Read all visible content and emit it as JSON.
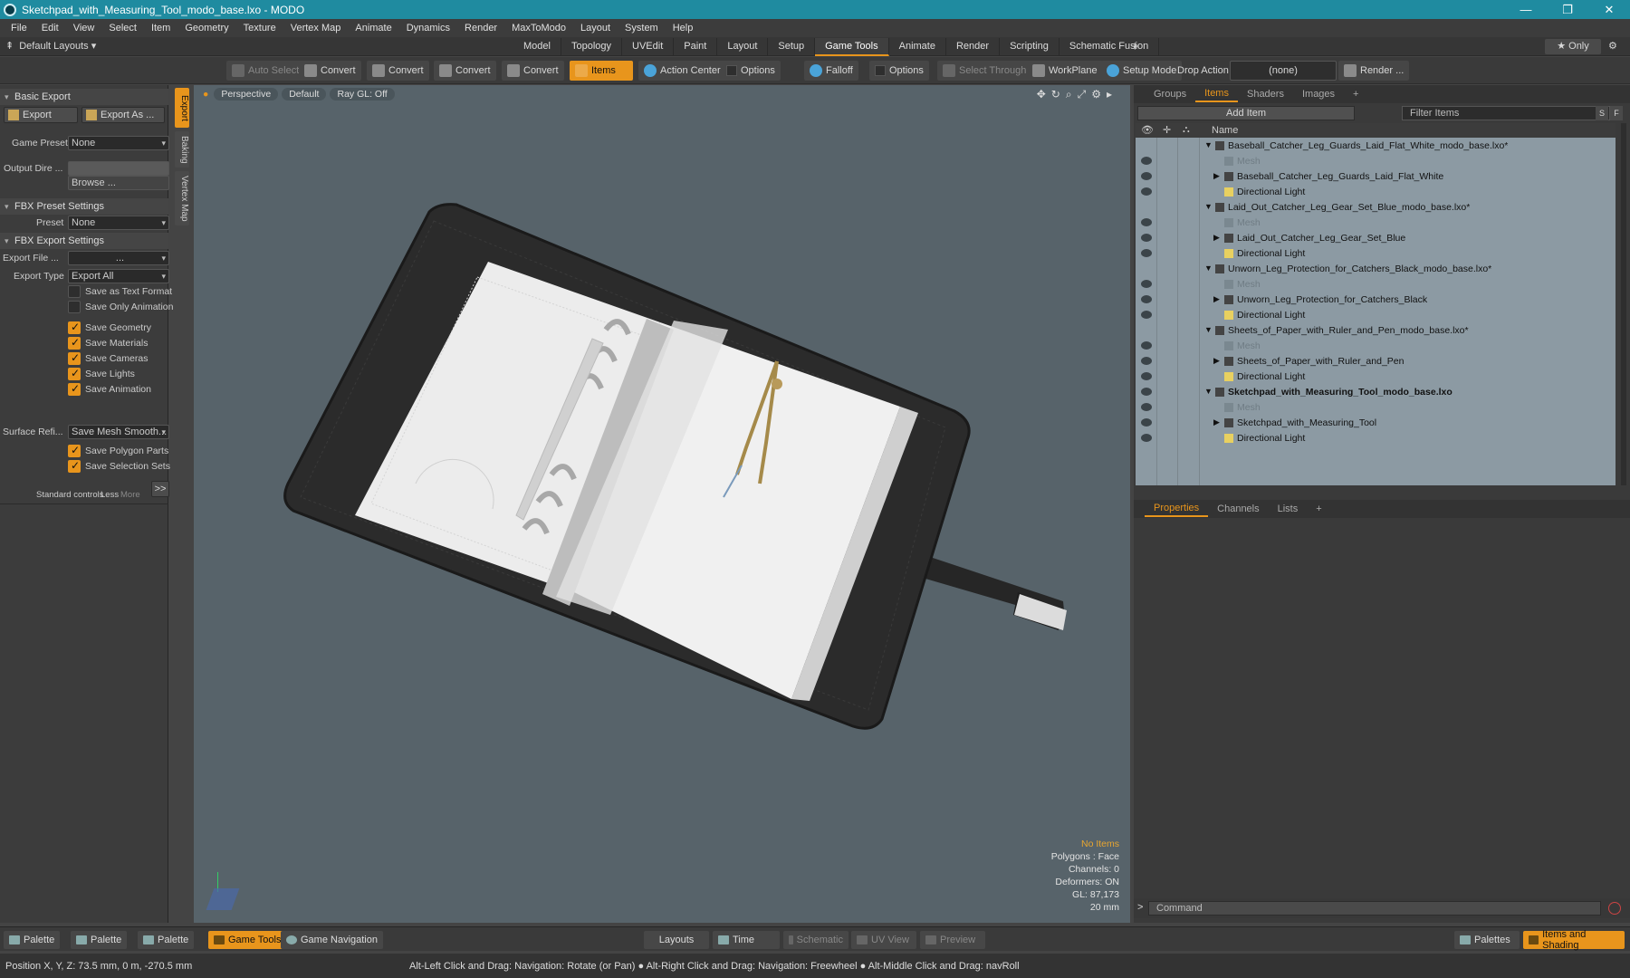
{
  "window": {
    "title": "Sketchpad_with_Measuring_Tool_modo_base.lxo - MODO",
    "min": "—",
    "max": "❐",
    "close": "✕"
  },
  "menu": [
    "File",
    "Edit",
    "View",
    "Select",
    "Item",
    "Geometry",
    "Texture",
    "Vertex Map",
    "Animate",
    "Dynamics",
    "Render",
    "MaxToModo",
    "Layout",
    "System",
    "Help"
  ],
  "layoutbar": {
    "default_layouts": "Default Layouts ▾",
    "tabs": [
      "Model",
      "Topology",
      "UVEdit",
      "Paint",
      "Layout",
      "Setup",
      "Game Tools",
      "Animate",
      "Render",
      "Scripting",
      "Schematic Fusion"
    ],
    "active_tab": "Game Tools",
    "plus": "+",
    "only": "★ Only"
  },
  "toolbar": {
    "auto_select": "Auto Select",
    "convert1": "Convert",
    "convert2": "Convert",
    "convert3": "Convert",
    "convert4": "Convert",
    "items": "Items",
    "action_center": "Action Center",
    "options1": "Options",
    "falloff": "Falloff",
    "options2": "Options",
    "select_through": "Select Through",
    "workplane": "WorkPlane",
    "setup_mode": "Setup Mode",
    "drop_action": "Drop Action",
    "drop_value": "(none)",
    "render": "Render ..."
  },
  "left": {
    "basic_export": "Basic Export",
    "export": "Export",
    "export_as": "Export As ...",
    "game_preset_label": "Game Preset",
    "game_preset": "None",
    "output_dir_label": "Output Dire ...",
    "browse": "Browse ...",
    "fbx_preset_settings": "FBX Preset Settings",
    "preset_label": "Preset",
    "preset": "None",
    "fbx_export_settings": "FBX Export Settings",
    "export_file_label": "Export File ...",
    "export_file": "...",
    "export_type_label": "Export Type",
    "export_type": "Export All",
    "checks": [
      {
        "label": "Save as Text Format",
        "on": false
      },
      {
        "label": "Save Only Animation",
        "on": false
      },
      {
        "label": "Save Geometry",
        "on": true
      },
      {
        "label": "Save Materials",
        "on": true
      },
      {
        "label": "Save Cameras",
        "on": true
      },
      {
        "label": "Save Lights",
        "on": true
      },
      {
        "label": "Save Animation",
        "on": true
      }
    ],
    "surface_label": "Surface Refi...",
    "surface_value": "Save Mesh Smooth...",
    "checks2": [
      {
        "label": "Save Polygon Parts",
        "on": true
      },
      {
        "label": "Save Selection Sets",
        "on": true
      }
    ],
    "standard_controls": "Standard controls",
    "less": "Less",
    "more": "More",
    "expand": ">>",
    "vtabs": [
      "Export",
      "Baking",
      "Vertex Map"
    ]
  },
  "viewport": {
    "perspective": "Perspective",
    "default": "Default",
    "raygl": "Ray GL: Off",
    "info": {
      "no_items": "No Items",
      "polygons": "Polygons : Face",
      "channels": "Channels: 0",
      "deformers": "Deformers: ON",
      "gl": "GL: 87,173",
      "scale": "20 mm"
    }
  },
  "right": {
    "tabs": [
      "Groups",
      "Items",
      "Shaders",
      "Images"
    ],
    "active": "Items",
    "plus": "+",
    "add_item": "Add Item",
    "filter": "Filter Items",
    "s": "S",
    "f": "F",
    "col_name": "Name",
    "rows": [
      {
        "name": "Baseball_Catcher_Leg_Guards_Laid_Flat_White_modo_base.lxo*",
        "lvl": 0,
        "eye": false,
        "bold": false,
        "dim": false
      },
      {
        "name": "Mesh",
        "lvl": 1,
        "eye": true,
        "bold": false,
        "dim": true
      },
      {
        "name": "Baseball_Catcher_Leg_Guards_Laid_Flat_White",
        "lvl": 1,
        "eye": true,
        "bold": false,
        "dim": false
      },
      {
        "name": "Directional Light",
        "lvl": 1,
        "eye": true,
        "bold": false,
        "dim": false
      },
      {
        "name": "Laid_Out_Catcher_Leg_Gear_Set_Blue_modo_base.lxo*",
        "lvl": 0,
        "eye": false,
        "bold": false,
        "dim": false
      },
      {
        "name": "Mesh",
        "lvl": 1,
        "eye": true,
        "bold": false,
        "dim": true
      },
      {
        "name": "Laid_Out_Catcher_Leg_Gear_Set_Blue",
        "lvl": 1,
        "eye": true,
        "bold": false,
        "dim": false
      },
      {
        "name": "Directional Light",
        "lvl": 1,
        "eye": true,
        "bold": false,
        "dim": false
      },
      {
        "name": "Unworn_Leg_Protection_for_Catchers_Black_modo_base.lxo*",
        "lvl": 0,
        "eye": false,
        "bold": false,
        "dim": false
      },
      {
        "name": "Mesh",
        "lvl": 1,
        "eye": true,
        "bold": false,
        "dim": true
      },
      {
        "name": "Unworn_Leg_Protection_for_Catchers_Black",
        "lvl": 1,
        "eye": true,
        "bold": false,
        "dim": false
      },
      {
        "name": "Directional Light",
        "lvl": 1,
        "eye": true,
        "bold": false,
        "dim": false
      },
      {
        "name": "Sheets_of_Paper_with_Ruler_and_Pen_modo_base.lxo*",
        "lvl": 0,
        "eye": false,
        "bold": false,
        "dim": false
      },
      {
        "name": "Mesh",
        "lvl": 1,
        "eye": true,
        "bold": false,
        "dim": true
      },
      {
        "name": "Sheets_of_Paper_with_Ruler_and_Pen",
        "lvl": 1,
        "eye": true,
        "bold": false,
        "dim": false
      },
      {
        "name": "Directional Light",
        "lvl": 1,
        "eye": true,
        "bold": false,
        "dim": false
      },
      {
        "name": "Sketchpad_with_Measuring_Tool_modo_base.lxo",
        "lvl": 0,
        "eye": true,
        "bold": true,
        "dim": false
      },
      {
        "name": "Mesh",
        "lvl": 1,
        "eye": true,
        "bold": false,
        "dim": true
      },
      {
        "name": "Sketchpad_with_Measuring_Tool",
        "lvl": 1,
        "eye": true,
        "bold": false,
        "dim": false
      },
      {
        "name": "Directional Light",
        "lvl": 1,
        "eye": true,
        "bold": false,
        "dim": false
      }
    ],
    "props_tabs": [
      "Properties",
      "Channels",
      "Lists"
    ],
    "props_active": "Properties",
    "command": "Command",
    "cmd_prompt": ">"
  },
  "bottom": {
    "palette1": "Palette",
    "palette2": "Palette",
    "palette3": "Palette",
    "game_tools": "Game Tools",
    "game_nav": "Game Navigation",
    "layouts": "Layouts",
    "time": "Time",
    "schematic": "Schematic",
    "uv_view": "UV View",
    "preview": "Preview",
    "palettes": "Palettes",
    "items_shading": "Items and Shading"
  },
  "status": {
    "position": "Position X, Y, Z:  73.5 mm, 0 m, -270.5 mm",
    "hint": "Alt-Left Click and Drag: Navigation: Rotate (or Pan) ● Alt-Right Click and Drag: Navigation: Freewheel ● Alt-Middle Click and Drag: navRoll"
  }
}
